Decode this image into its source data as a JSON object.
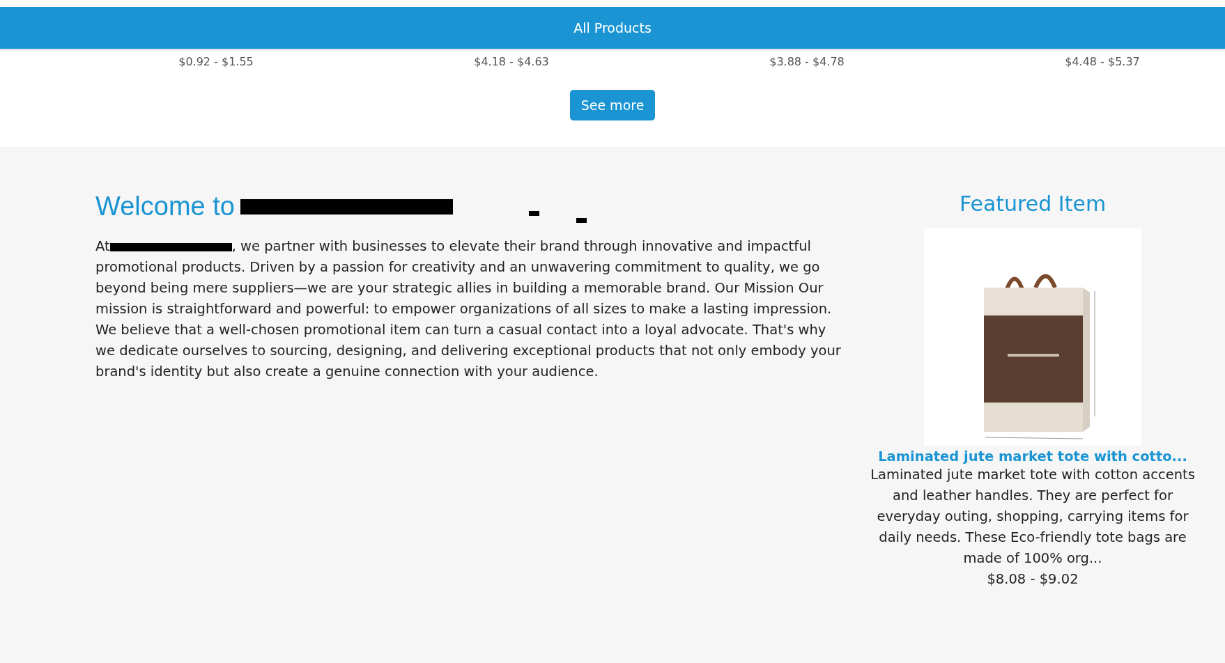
{
  "header": {
    "title": "All Products"
  },
  "prices": [
    "$0.92 - $1.55",
    "$4.18 - $4.63",
    "$3.88 - $4.78",
    "$4.48 - $5.37"
  ],
  "see_more": "See more",
  "welcome": {
    "heading": "Welcome to",
    "intro_start": "At",
    "intro_rest": ", we partner with businesses to elevate their brand through innovative and impactful promotional products. Driven by a passion for creativity and an unwavering commitment to quality, we go beyond being mere suppliers—we are your strategic allies in building a memorable brand. Our Mission Our mission is straightforward and powerful: to empower organizations of all sizes to make a lasting impression. We believe that a well-chosen promotional item can turn a casual contact into a loyal advocate. That's why we dedicate ourselves to sourcing, designing, and delivering exceptional products that not only embody your brand's identity but also create a genuine connection with your audience."
  },
  "featured": {
    "heading": "Featured Item",
    "title": "Laminated jute market tote with cotto...",
    "description": "Laminated jute market tote with cotton accents and leather handles. They are perfect for everyday outing, shopping, carrying items for daily needs. These Eco-friendly tote bags are made of 100% org...",
    "price": "$8.08 - $9.02"
  }
}
